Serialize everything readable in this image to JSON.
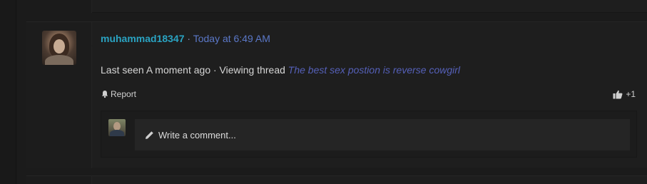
{
  "post": {
    "username": "muhammad18347",
    "separator": "·",
    "timestamp": "Today at 6:49 AM",
    "status_prefix": "Last seen A moment ago · Viewing thread",
    "thread_title": "The best sex postion is reverse cowgirl",
    "report_label": "Report",
    "like_count": "+1"
  },
  "comment": {
    "placeholder": "Write a comment..."
  },
  "icons": {
    "report": "bell-icon",
    "like": "thumbs-up-icon",
    "comment": "pencil-icon"
  },
  "colors": {
    "username": "#2aa3c2",
    "timestamp": "#5b78c8",
    "thread_link": "#5560b8",
    "background": "#1b1b1b"
  }
}
